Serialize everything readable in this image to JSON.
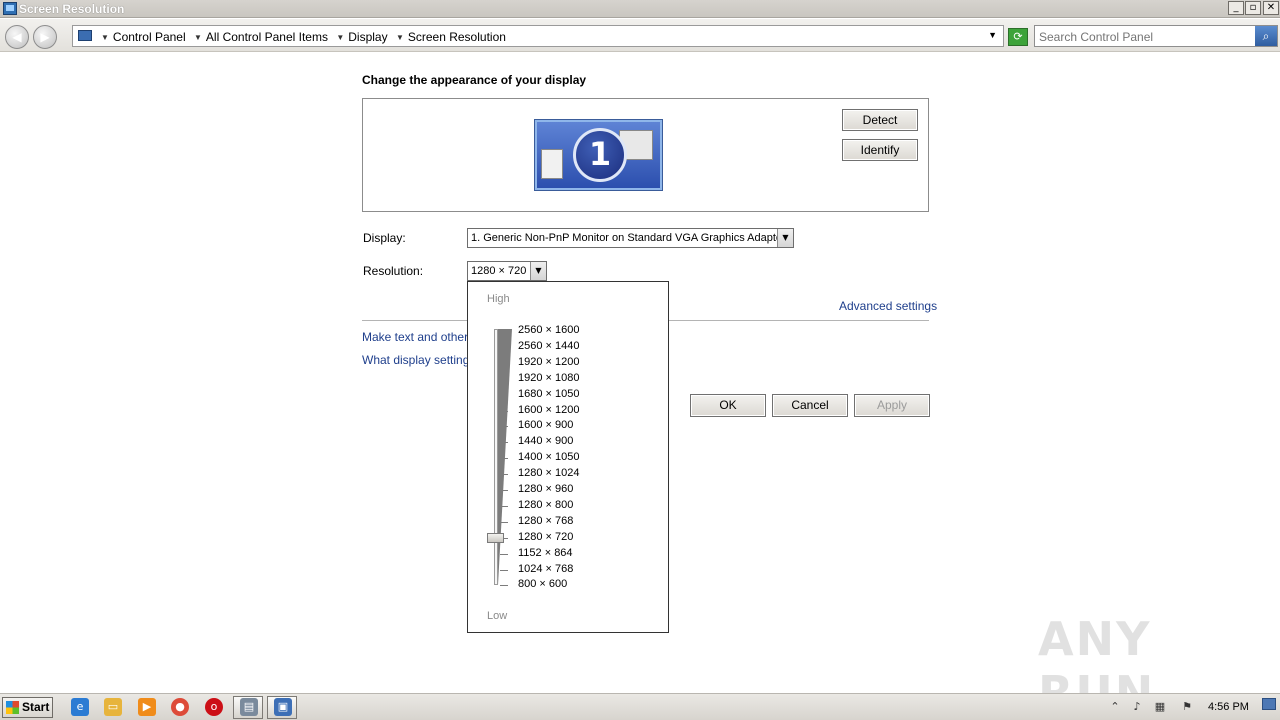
{
  "window": {
    "title": "Screen Resolution",
    "controls": {
      "minimize": "_",
      "maximize": "▫",
      "close": "✕"
    }
  },
  "addressbar": {
    "breadcrumbs": [
      "Control Panel",
      "All Control Panel Items",
      "Display",
      "Screen Resolution"
    ],
    "search_placeholder": "Search Control Panel"
  },
  "main": {
    "heading": "Change the appearance of your display",
    "monitor_number": "1",
    "detect_label": "Detect",
    "identify_label": "Identify",
    "display_label": "Display:",
    "display_value": "1. Generic Non-PnP Monitor on Standard VGA Graphics Adapter",
    "resolution_label": "Resolution:",
    "resolution_value": "1280 × 720",
    "advanced_link": "Advanced settings",
    "link_text_size": "Make text and other i",
    "link_settings": "What display settings",
    "ok_label": "OK",
    "cancel_label": "Cancel",
    "apply_label": "Apply"
  },
  "resolution_dropdown": {
    "high_label": "High",
    "low_label": "Low",
    "options": [
      "2560 × 1600",
      "2560 × 1440",
      "1920 × 1200",
      "1920 × 1080",
      "1680 × 1050",
      "1600 × 1200",
      "1600 × 900",
      "1440 × 900",
      "1400 × 1050",
      "1280 × 1024",
      "1280 × 960",
      "1280 × 800",
      "1280 × 768",
      "1280 × 720",
      "1152 × 864",
      "1024 × 768",
      "800 × 600"
    ],
    "selected": "1280 × 720"
  },
  "watermark": "ANY RUN",
  "taskbar": {
    "start_label": "Start",
    "clock": "4:56 PM"
  }
}
